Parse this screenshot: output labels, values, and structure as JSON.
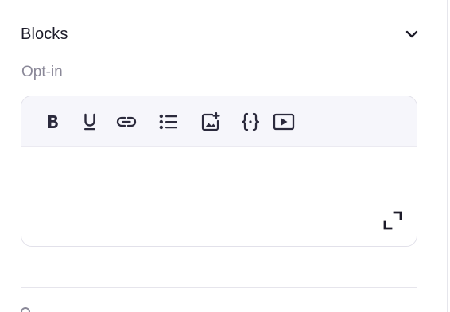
{
  "section": {
    "title": "Blocks",
    "toggle_icon": "chevron-down-icon"
  },
  "field": {
    "label": "Opt-in"
  },
  "toolbar": {
    "buttons": [
      {
        "name": "bold",
        "icon": "bold-icon"
      },
      {
        "name": "underline",
        "icon": "underline-icon"
      },
      {
        "name": "link",
        "icon": "link-icon"
      },
      {
        "name": "bulleted-list",
        "icon": "bulleted-list-icon"
      },
      {
        "name": "insert-image",
        "icon": "image-add-icon"
      },
      {
        "name": "insert-variable",
        "icon": "curly-braces-icon"
      },
      {
        "name": "insert-video",
        "icon": "video-play-icon"
      }
    ]
  },
  "editor": {
    "content": "",
    "expand_icon": "expand-icon"
  },
  "colors": {
    "text_primary": "#1c1b29",
    "text_muted": "#8a8898",
    "toolbar_bg": "#f6f6fb",
    "border": "#e2e1ea",
    "icon": "#2b2a3c"
  }
}
